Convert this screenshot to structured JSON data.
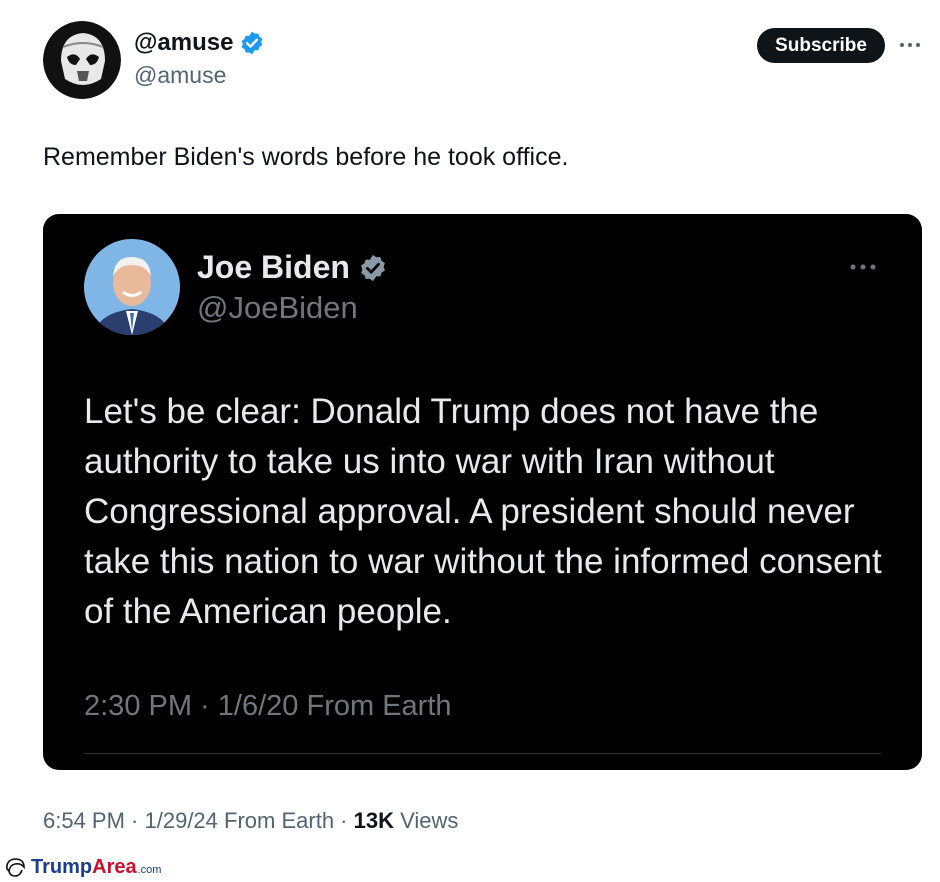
{
  "tweet": {
    "author_name": "@amuse",
    "author_handle": "@amuse",
    "subscribe_label": "Subscribe",
    "text": "Remember Biden's words before he took office.",
    "time": "6:54 PM",
    "date": "1/29/24",
    "source": "From Earth",
    "views_count": "13K",
    "views_label": "Views"
  },
  "quoted_tweet": {
    "author_name": "Joe Biden",
    "author_handle": "@JoeBiden",
    "text": "Let's be clear: Donald Trump does not have the authority to take us into war with Iran without Congressional approval. A president should never take this nation to war without the informed consent of the American people.",
    "time": "2:30 PM",
    "date": "1/6/20",
    "source": "From Earth"
  },
  "watermark": {
    "part1": "Trump",
    "part2": "Area",
    "suffix": ".com"
  },
  "colors": {
    "verified": "#1d9bf0",
    "dark_card": "#000000",
    "secondary_text": "#536471"
  },
  "icons": [
    "verified-badge-icon",
    "more-options-icon",
    "trump-hair-logo-icon"
  ]
}
